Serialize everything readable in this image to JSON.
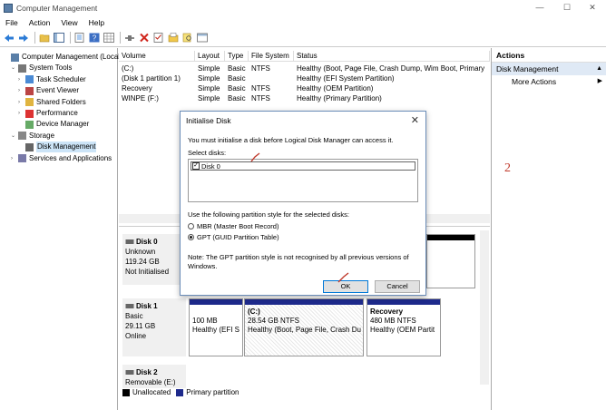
{
  "window": {
    "title": "Computer Management",
    "minimize_glyph": "—",
    "maximize_glyph": "☐",
    "close_glyph": "✕"
  },
  "menu": [
    "File",
    "Action",
    "View",
    "Help"
  ],
  "toolbar_icons": [
    "back-arrow-icon",
    "forward-arrow-icon",
    "up-folder-icon",
    "console-tree-icon",
    "properties-icon",
    "help-icon",
    "connect-icon",
    "delete-icon",
    "checklist-icon",
    "folder-icon",
    "search-icon",
    "view-icon"
  ],
  "tree": [
    {
      "label": "Computer Management (Local)",
      "indent": 0,
      "arrow": "",
      "icon": "computer-icon"
    },
    {
      "label": "System Tools",
      "indent": 1,
      "arrow": "⌄",
      "icon": "tools-icon"
    },
    {
      "label": "Task Scheduler",
      "indent": 2,
      "arrow": "›",
      "icon": "clock-icon"
    },
    {
      "label": "Event Viewer",
      "indent": 2,
      "arrow": "›",
      "icon": "event-icon"
    },
    {
      "label": "Shared Folders",
      "indent": 2,
      "arrow": "›",
      "icon": "shared-folder-icon"
    },
    {
      "label": "Performance",
      "indent": 2,
      "arrow": "›",
      "icon": "performance-icon"
    },
    {
      "label": "Device Manager",
      "indent": 2,
      "arrow": "",
      "icon": "device-icon"
    },
    {
      "label": "Storage",
      "indent": 1,
      "arrow": "⌄",
      "icon": "storage-icon"
    },
    {
      "label": "Disk Management",
      "indent": 2,
      "arrow": "",
      "icon": "disk-icon",
      "selected": true
    },
    {
      "label": "Services and Applications",
      "indent": 1,
      "arrow": "›",
      "icon": "services-icon"
    }
  ],
  "volumes": {
    "headers": [
      "Volume",
      "Layout",
      "Type",
      "File System",
      "Status"
    ],
    "rows": [
      [
        "(C:)",
        "Simple",
        "Basic",
        "NTFS",
        "Healthy (Boot, Page File, Crash Dump, Wim Boot, Primary"
      ],
      [
        "(Disk 1 partition 1)",
        "Simple",
        "Basic",
        "",
        "Healthy (EFI System Partition)"
      ],
      [
        "Recovery",
        "Simple",
        "Basic",
        "NTFS",
        "Healthy (OEM Partition)"
      ],
      [
        "WINPE (F:)",
        "Simple",
        "Basic",
        "NTFS",
        "Healthy (Primary Partition)"
      ]
    ]
  },
  "disks": [
    {
      "name": "Disk 0",
      "lines": [
        "Unknown",
        "119.24 GB",
        "Not Initialised"
      ]
    },
    {
      "name": "Disk 1",
      "lines": [
        "Basic",
        "29.11 GB",
        "Online"
      ]
    },
    {
      "name": "Disk 2",
      "lines": [
        "Removable (E:)"
      ]
    }
  ],
  "partitions": [
    {
      "title": "",
      "size": "100 MB",
      "status": "Healthy (EFI S"
    },
    {
      "title": "(C:)",
      "size": "28.54 GB NTFS",
      "status": "Healthy (Boot, Page File, Crash Du"
    },
    {
      "title": "Recovery",
      "size": "480 MB NTFS",
      "status": "Healthy (OEM Partit"
    }
  ],
  "legend": [
    {
      "label": "Unallocated",
      "color": "#000000"
    },
    {
      "label": "Primary partition",
      "color": "#1e2a8c"
    }
  ],
  "actions": {
    "header": "Actions",
    "section": "Disk Management",
    "section_glyph": "▲",
    "more": "More Actions",
    "more_glyph": "▶"
  },
  "annotation": "2",
  "dialog": {
    "title": "Initialise Disk",
    "close_glyph": "✕",
    "intro": "You must initialise a disk before Logical Disk Manager can access it.",
    "select_label": "Select disks:",
    "disk_item": "Disk 0",
    "disk_checked_glyph": "✓",
    "style_label": "Use the following partition style for the selected disks:",
    "options": [
      {
        "label": "MBR (Master Boot Record)",
        "selected": false
      },
      {
        "label": "GPT (GUID Partition Table)",
        "selected": true
      }
    ],
    "note_line1": "Note: The GPT partition style is not recognised by all previous versions of",
    "note_line2": "Windows.",
    "ok": "OK",
    "cancel": "Cancel"
  },
  "colors": {
    "primary_partition": "#1e2a8c",
    "selection": "#cce4f7",
    "annotation_red": "#c0392b"
  }
}
